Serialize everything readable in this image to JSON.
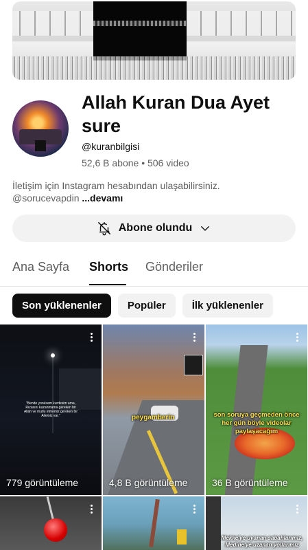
{
  "channel": {
    "name": "Allah Kuran Dua Ayet sure",
    "handle": "@kuranbilgisi",
    "subscribers": "52,6 B abone",
    "separator": "•",
    "videos": "506 video",
    "description_line1": "İletişim için Instagram hesabından ulaşabilirsiniz.",
    "description_line2": "@sorucevapdin",
    "description_more": "...devamı"
  },
  "subscribe_button": {
    "label": "Abone olundu",
    "icon": "bell-off-icon",
    "dropdown_icon": "chevron-down-icon"
  },
  "tabs": [
    {
      "label": "Ana Sayfa",
      "active": false
    },
    {
      "label": "Shorts",
      "active": true
    },
    {
      "label": "Gönderiler",
      "active": false
    }
  ],
  "filters": [
    {
      "label": "Son yüklenenler",
      "selected": true
    },
    {
      "label": "Popüler",
      "selected": false
    },
    {
      "label": "İlk yüklenenler",
      "selected": false
    }
  ],
  "shorts": [
    {
      "views": "779 görüntüleme",
      "caption": "\"Bende yorulsam kurdesim ama, Rızasını kazanmama gereken bir Allah ve mutlu etmemiz gereken bir Ailemiz var.\""
    },
    {
      "views": "4,8 B görüntüleme",
      "caption": "peygamberin"
    },
    {
      "views": "36 B görüntüleme",
      "caption": "son soruya geçmeden önce her gün böyle videolar paylaşacağım"
    },
    {
      "views": "",
      "caption": ""
    },
    {
      "views": "",
      "caption": ""
    },
    {
      "views": "",
      "caption": "Mekke'ye uyanan sabahlarımız, Medine'ye uzanan yollarımız"
    }
  ],
  "colors": {
    "accent": "#0f0f0f",
    "secondary_text": "#606060",
    "chip_bg": "#f2f2f2",
    "caption_yellow": "#ffe04a"
  }
}
